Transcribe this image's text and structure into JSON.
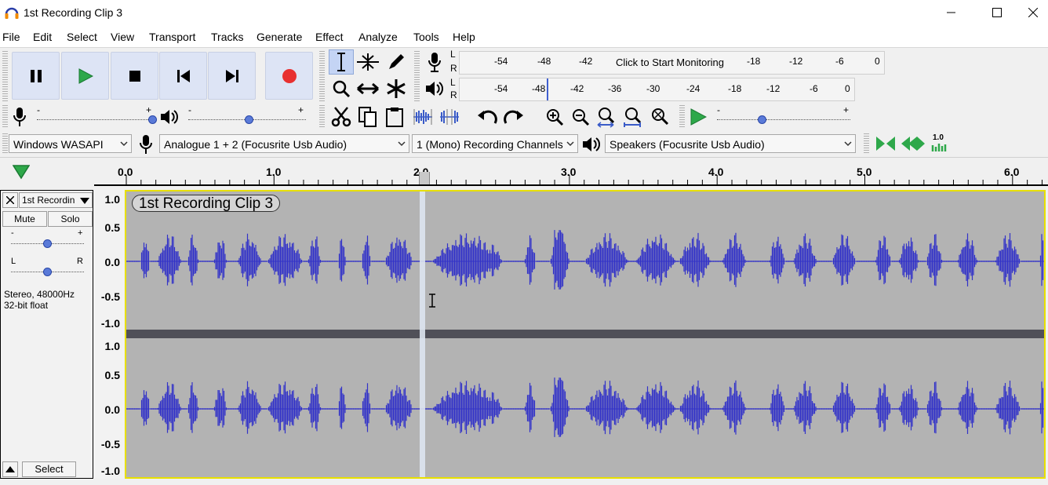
{
  "window": {
    "title": "1st Recording Clip 3"
  },
  "menu": [
    "File",
    "Edit",
    "Select",
    "View",
    "Transport",
    "Tracks",
    "Generate",
    "Effect",
    "Analyze",
    "Tools",
    "Help"
  ],
  "record_meter": {
    "channels": [
      "L",
      "R"
    ],
    "ticks": [
      "-54",
      "-48",
      "-42",
      "-18",
      "-12",
      "-6",
      "0"
    ],
    "prompt": "Click to Start Monitoring"
  },
  "playback_meter": {
    "channels": [
      "L",
      "R"
    ],
    "ticks": [
      "-54",
      "-48",
      "-42",
      "-36",
      "-30",
      "-24",
      "-18",
      "-12",
      "-6",
      "0"
    ]
  },
  "mixer": {
    "mic_min": "-",
    "mic_max": "+",
    "spk_min": "-",
    "spk_max": "+",
    "play_speed_min": "-",
    "play_speed_max": "+"
  },
  "devices": {
    "host": "Windows WASAPI",
    "input": "Analogue 1 + 2 (Focusrite Usb Audio)",
    "channels": "1 (Mono) Recording Channels",
    "output": "Speakers (Focusrite Usb Audio)"
  },
  "spectral": {
    "value": "1.0"
  },
  "timeline": {
    "labels": [
      "0.0",
      "1.0",
      "2.0",
      "3.0",
      "4.0",
      "5.0",
      "6.0"
    ]
  },
  "track": {
    "name": "1st Recording Clip 3",
    "short_name": "1st Recordin",
    "mute_label": "Mute",
    "solo_label": "Solo",
    "gain_min": "-",
    "gain_max": "+",
    "pan_left": "L",
    "pan_right": "R",
    "info_line1": "Stereo, 48000Hz",
    "info_line2": "32-bit float",
    "select_label": "Select",
    "clip_name": "1st Recording Clip 3",
    "scale": [
      "1.0",
      "0.5",
      "0.0",
      "-0.5",
      "-1.0"
    ]
  },
  "colors": {
    "waveform": "#3232c8",
    "waveform_light": "#6464dc",
    "track_bg": "#b3b3b3",
    "selection_border": "#e8e000",
    "record_red": "#e83030",
    "play_green": "#2ea84a"
  }
}
